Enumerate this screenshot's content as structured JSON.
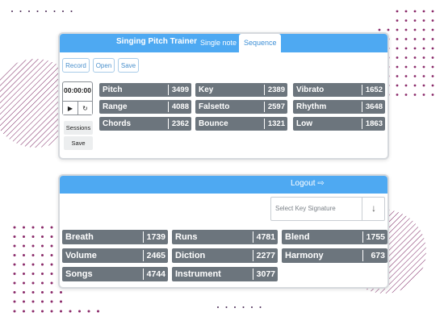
{
  "colors": {
    "accent": "#4ea9f2",
    "chip": "#6c757d",
    "decor": "#7a2360"
  },
  "header": {
    "title": "Singing Pitch Trainer",
    "tabs": [
      {
        "label": "Single note",
        "active": false
      },
      {
        "label": "Sequence",
        "active": true
      }
    ]
  },
  "toolbar": {
    "record": "Record",
    "open": "Open",
    "save": "Save"
  },
  "player": {
    "time": "00:00:00",
    "play_icon": "play-icon",
    "reset_icon": "reset-icon",
    "play_symbol": "▶",
    "reset_symbol": "↻"
  },
  "side": {
    "sessions": "Sessions",
    "save": "Save"
  },
  "exercises": [
    {
      "label": "Pitch",
      "count": "3499"
    },
    {
      "label": "Key",
      "count": "2389"
    },
    {
      "label": "Vibrato",
      "count": "1652"
    },
    {
      "label": "Range",
      "count": "4088"
    },
    {
      "label": "Falsetto",
      "count": "2597"
    },
    {
      "label": "Rhythm",
      "count": "3648"
    },
    {
      "label": "Chords",
      "count": "2362"
    },
    {
      "label": "Bounce",
      "count": "1321"
    },
    {
      "label": "Low",
      "count": "1863"
    }
  ],
  "account": {
    "logout": "Logout ⇨",
    "logout_icon": "sign-out-icon"
  },
  "key_signature": {
    "placeholder": "Select Key Signature",
    "arrow": "↓"
  },
  "topics": [
    {
      "label": "Breath",
      "count": "1739"
    },
    {
      "label": "Runs",
      "count": "4781"
    },
    {
      "label": "Blend",
      "count": "1755"
    },
    {
      "label": "Volume",
      "count": "2465"
    },
    {
      "label": "Diction",
      "count": "2277"
    },
    {
      "label": "Harmony",
      "count": "673"
    },
    {
      "label": "Songs",
      "count": "4744"
    },
    {
      "label": "Instrument",
      "count": "3077"
    }
  ]
}
